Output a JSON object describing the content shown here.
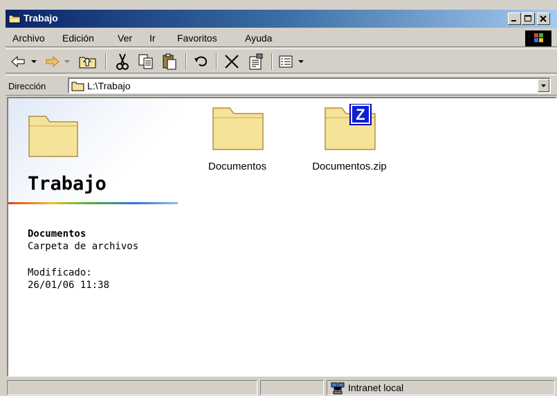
{
  "window": {
    "title": "Trabajo"
  },
  "menu": [
    "Archivo",
    "Edición",
    "Ver",
    "Ir",
    "Favoritos",
    "Ayuda"
  ],
  "address": {
    "label": "Dirección",
    "value": "L:\\Trabajo"
  },
  "left_panel": {
    "folder_title": "Trabajo",
    "selected_name": "Documentos",
    "selected_type": "Carpeta de archivos",
    "modified_label": "Modificado:",
    "modified_date": "26/01/06 11:38"
  },
  "files": [
    {
      "name": "Documentos",
      "icon": "folder-icon"
    },
    {
      "name": "Documentos.zip",
      "icon": "zip-folder-icon"
    }
  ],
  "status": {
    "zone": "Intranet local"
  },
  "colors": {
    "titlebar_start": "#0a246a",
    "titlebar_end": "#a6caf0",
    "folder": "#f5e39a"
  }
}
